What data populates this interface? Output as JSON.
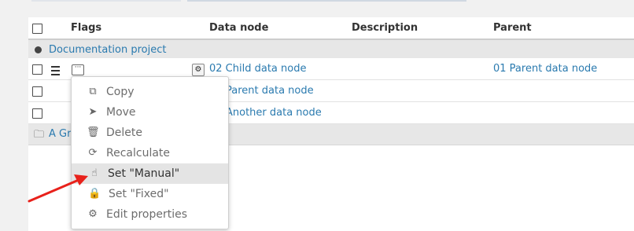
{
  "table": {
    "headers": {
      "flags": "Flags",
      "data_node": "Data node",
      "description": "Description",
      "parent": "Parent"
    },
    "project_label": "Documentation project",
    "rows": [
      {
        "data_node": "02 Child data node",
        "parent": "01 Parent data node"
      },
      {
        "data_node": "Parent data node",
        "parent": ""
      },
      {
        "data_node": "Another data node",
        "parent": ""
      }
    ],
    "group_label": "A Gr"
  },
  "context_menu": {
    "items": [
      {
        "label": "Copy",
        "icon": "copy-icon"
      },
      {
        "label": "Move",
        "icon": "paper-plane-icon"
      },
      {
        "label": "Delete",
        "icon": "trash-icon"
      },
      {
        "label": "Recalculate",
        "icon": "refresh-icon"
      },
      {
        "label": "Set \"Manual\"",
        "icon": "pointer-hand-icon"
      },
      {
        "label": "Set \"Fixed\"",
        "icon": "lock-icon"
      },
      {
        "label": "Edit properties",
        "icon": "gears-icon"
      }
    ],
    "hovered_item": "Set \"Manual\""
  },
  "colors": {
    "link": "#2a7aaf",
    "arrow": "#e8211b",
    "group_row_bg": "#e7e7e7",
    "hover_bg": "#e4e4e4"
  }
}
